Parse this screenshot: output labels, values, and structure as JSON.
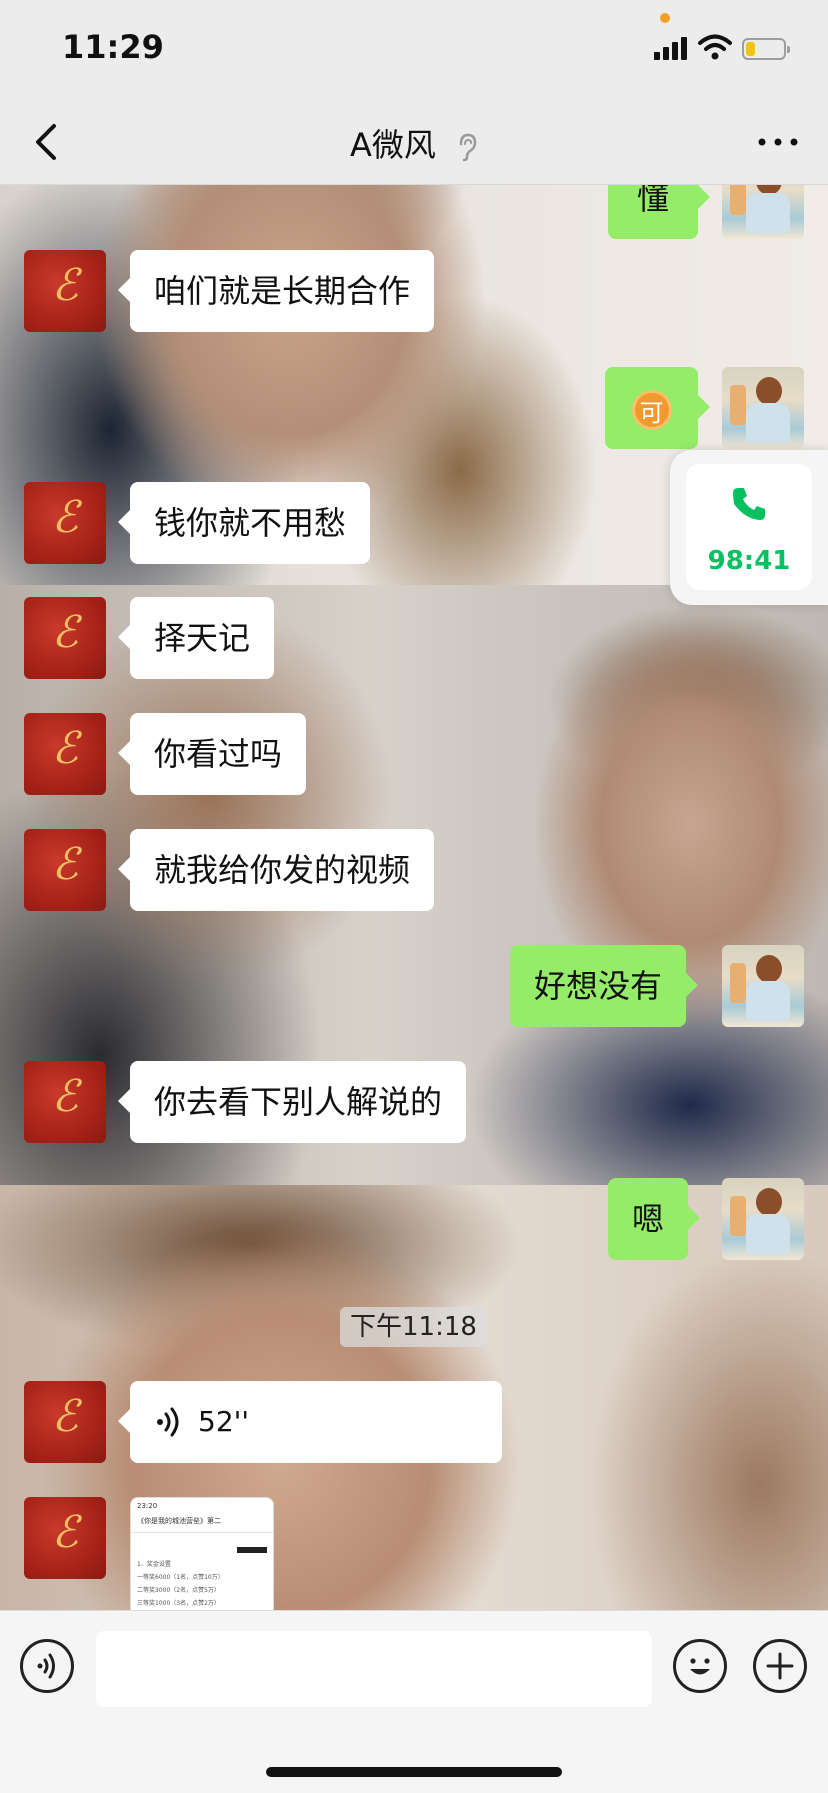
{
  "status_bar": {
    "time": "11:29",
    "battery_level": 0.25
  },
  "nav": {
    "title": "A微风",
    "back_icon": "chevron-left-icon",
    "more_icon": "more-dots-icon",
    "muted_icon": "ear-icon"
  },
  "messages": [
    {
      "side": "out",
      "text": "懂",
      "partial": true
    },
    {
      "side": "in",
      "text": "咱们就是长期合作"
    },
    {
      "side": "out",
      "text": "可",
      "sticker": true
    },
    {
      "side": "in",
      "text": "钱你就不用愁"
    },
    {
      "side": "in",
      "text": "择天记"
    },
    {
      "side": "in",
      "text": "你看过吗"
    },
    {
      "side": "in",
      "text": "就我给你发的视频"
    },
    {
      "side": "out",
      "text": "好想没有"
    },
    {
      "side": "in",
      "text": "你去看下别人解说的"
    },
    {
      "side": "out",
      "text": "嗯"
    }
  ],
  "timestamp": "下午11:18",
  "voice_message": {
    "duration": "52''"
  },
  "call_widget": {
    "duration": "98:41"
  },
  "thumbnail": {
    "status_time": "23:20",
    "title": "《你是我的城池营垒》第二",
    "lines": [
      "1、奖金设置",
      "一等奖6000（1名，点赞10万）",
      "二等奖3000（2名，点赞5万）",
      "三等奖1000（3名，点赞2万）"
    ]
  },
  "input": {
    "placeholder": ""
  },
  "colors": {
    "outgoing_bubble": "#95ec69",
    "incoming_bubble": "#ffffff",
    "accent": "#07c160"
  }
}
